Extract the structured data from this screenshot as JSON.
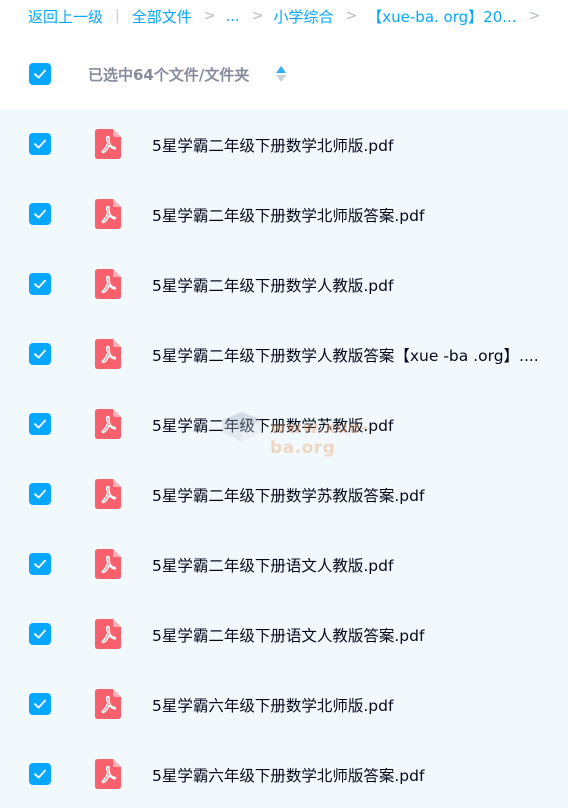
{
  "breadcrumb": {
    "back": "返回上一级",
    "all_files": "全部文件",
    "ellipsis": "...",
    "level1": "小学综合",
    "level2": "【xue-ba. org】20..."
  },
  "header": {
    "selected_label": "已选中64个文件/文件夹"
  },
  "watermark": {
    "text": "www.xue-ba.org"
  },
  "files": [
    {
      "name": "5星学霸二年级下册数学北师版.pdf",
      "checked": true,
      "icon": "pdf-icon"
    },
    {
      "name": "5星学霸二年级下册数学北师版答案.pdf",
      "checked": true,
      "icon": "pdf-icon"
    },
    {
      "name": "5星学霸二年级下册数学人教版.pdf",
      "checked": true,
      "icon": "pdf-icon"
    },
    {
      "name": "5星学霸二年级下册数学人教版答案【xue -ba .org】....",
      "checked": true,
      "icon": "pdf-icon"
    },
    {
      "name": "5星学霸二年级下册数学苏教版.pdf",
      "checked": true,
      "icon": "pdf-icon"
    },
    {
      "name": "5星学霸二年级下册数学苏教版答案.pdf",
      "checked": true,
      "icon": "pdf-icon"
    },
    {
      "name": "5星学霸二年级下册语文人教版.pdf",
      "checked": true,
      "icon": "pdf-icon"
    },
    {
      "name": "5星学霸二年级下册语文人教版答案.pdf",
      "checked": true,
      "icon": "pdf-icon"
    },
    {
      "name": "5星学霸六年级下册数学北师版.pdf",
      "checked": true,
      "icon": "pdf-icon"
    },
    {
      "name": "5星学霸六年级下册数学北师版答案.pdf",
      "checked": true,
      "icon": "pdf-icon"
    }
  ],
  "colors": {
    "accent": "#06a7ff",
    "pdf_red": "#f7606c",
    "row_bg": "#f2f9fd",
    "text": "#03081a",
    "muted": "#878c9c"
  }
}
